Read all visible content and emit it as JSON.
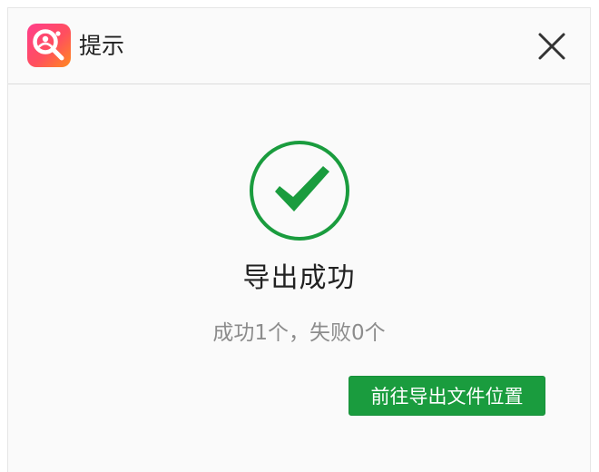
{
  "dialog": {
    "title": "提示",
    "logo_icon": "app-logo-icon",
    "close_icon": "close-icon"
  },
  "result": {
    "icon": "check-circle-icon",
    "headline": "导出成功",
    "summary": "成功1个，失败0个",
    "success_color": "#1a9c3e"
  },
  "actions": {
    "open_location_label": "前往导出文件位置"
  }
}
